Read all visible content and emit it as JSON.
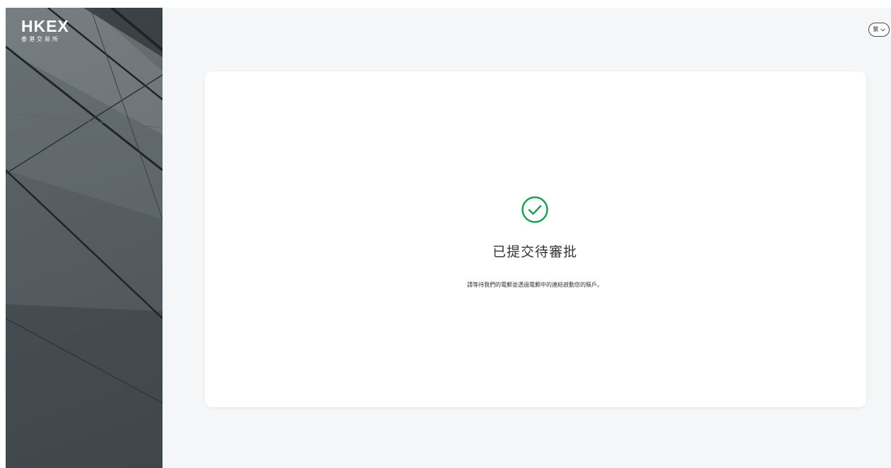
{
  "brand": {
    "logo_text": "HKEX",
    "logo_subtext": "香港交易所"
  },
  "language_switcher": {
    "icon": "language-icon",
    "glyph": "繁"
  },
  "status": {
    "icon": "check-circle-icon",
    "title": "已提交待審批",
    "message": "請等待我們的電郵並透過電郵中的連結啟動您的賬戶。"
  },
  "colors": {
    "success": "#1a9f53",
    "sidebar": "#5b6366",
    "background": "#f5f6f7"
  }
}
